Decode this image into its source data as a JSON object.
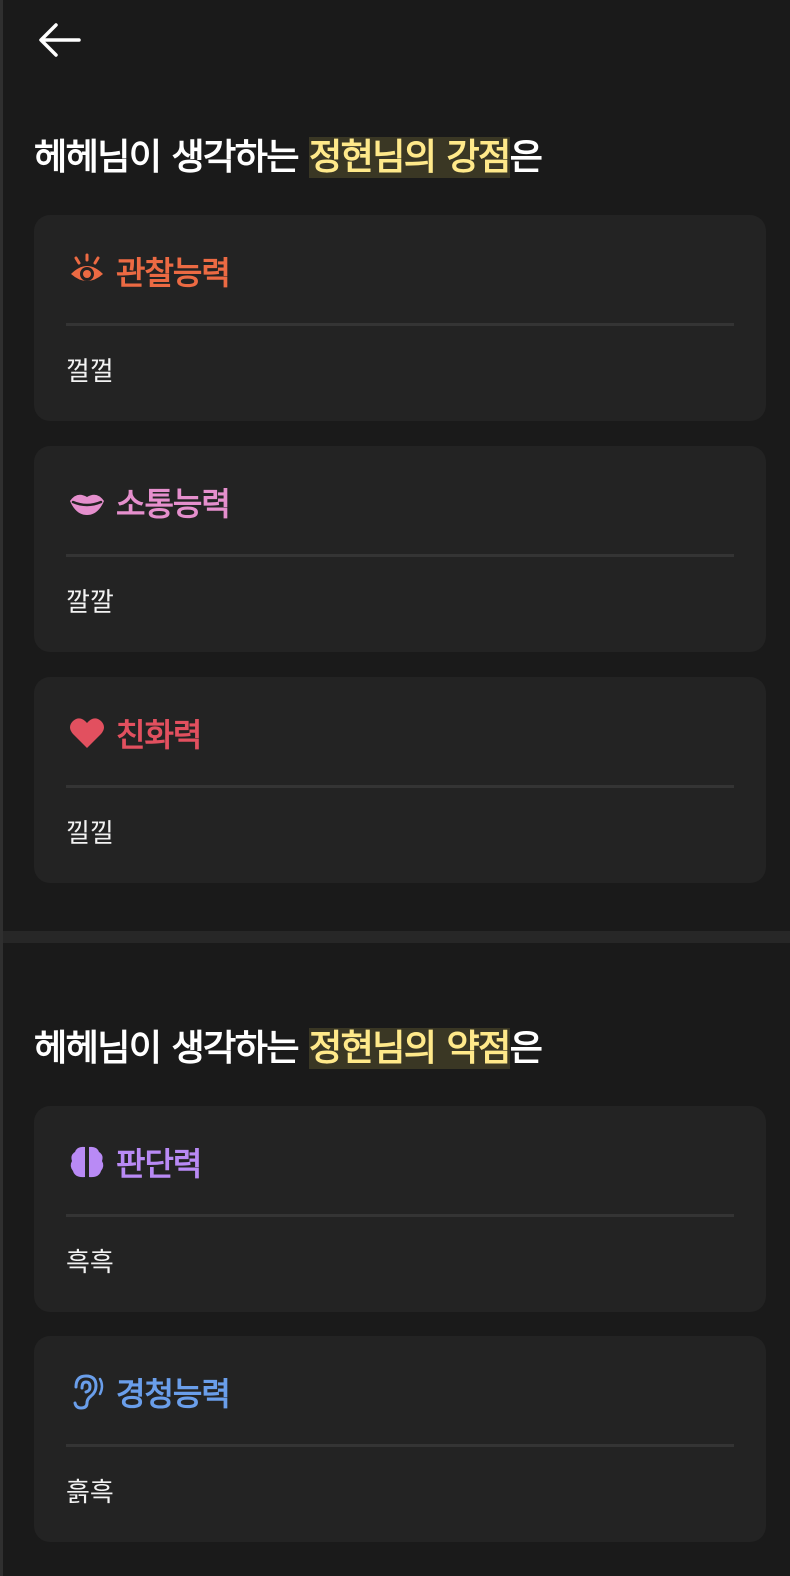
{
  "strengths": {
    "title_prefix": "헤헤님이 생각하는 ",
    "title_highlight": "정현님의 강점",
    "title_suffix": "은",
    "cards": [
      {
        "icon": "eye-icon",
        "label": "관찰능력",
        "text": "껄껄",
        "color": "#ec6a43"
      },
      {
        "icon": "lips-icon",
        "label": "소통능력",
        "text": "깔깔",
        "color": "#e58fcd"
      },
      {
        "icon": "heart-icon",
        "label": "친화력",
        "text": "낄낄",
        "color": "#e2505f"
      }
    ]
  },
  "weaknesses": {
    "title_prefix": "헤헤님이 생각하는 ",
    "title_highlight": "정현님의 약점",
    "title_suffix": "은",
    "cards": [
      {
        "icon": "brain-icon",
        "label": "판단력",
        "text": "흑흑",
        "color": "#b98af5"
      },
      {
        "icon": "ear-icon",
        "label": "경청능력",
        "text": "흙흑",
        "color": "#6a9eea"
      }
    ]
  },
  "colors": {
    "background": "#1a1a1a",
    "card": "#232323",
    "highlight_text": "#ffe98a",
    "highlight_bg": "#3a3724"
  }
}
